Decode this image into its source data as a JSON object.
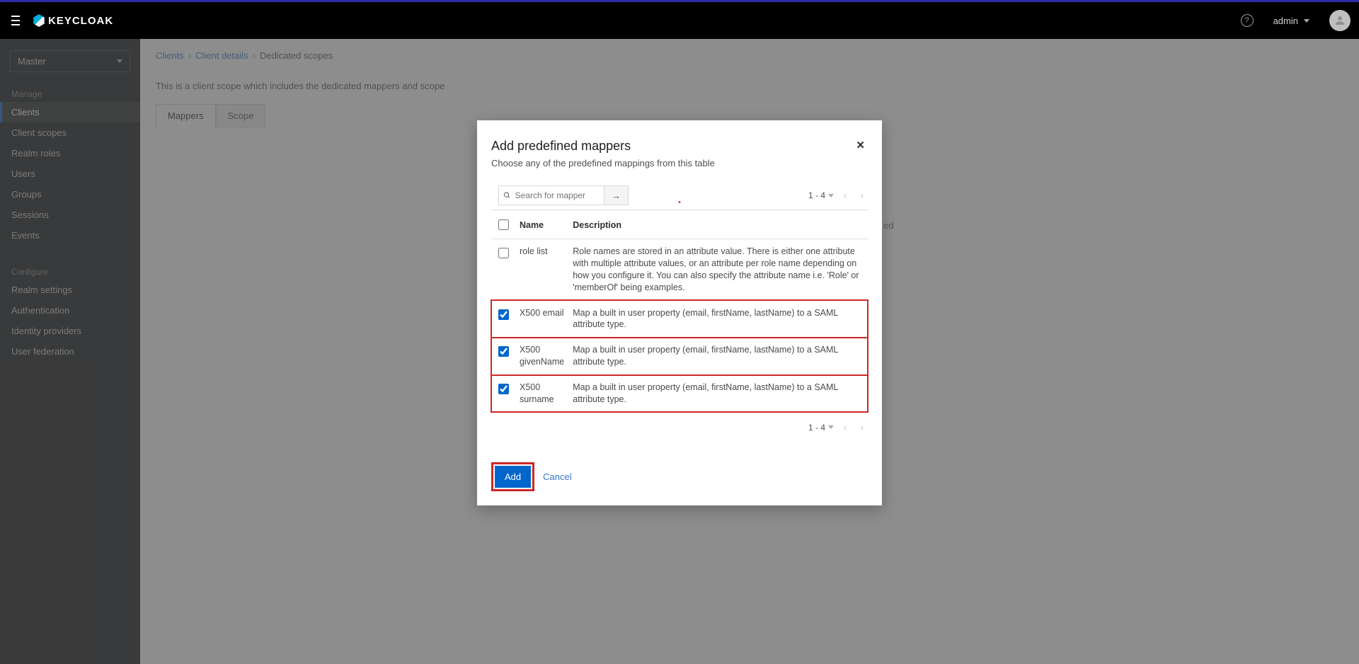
{
  "accentColor": "#2f2aa5",
  "brand": "KEYCLOAK",
  "header": {
    "user": "admin"
  },
  "realmSelector": {
    "selected": "Master"
  },
  "sidebar": {
    "sections": [
      {
        "label": "Manage",
        "items": [
          {
            "label": "Clients",
            "active": true
          },
          {
            "label": "Client scopes"
          },
          {
            "label": "Realm roles"
          },
          {
            "label": "Users"
          },
          {
            "label": "Groups"
          },
          {
            "label": "Sessions"
          },
          {
            "label": "Events"
          }
        ]
      },
      {
        "label": "Configure",
        "items": [
          {
            "label": "Realm settings"
          },
          {
            "label": "Authentication"
          },
          {
            "label": "Identity providers"
          },
          {
            "label": "User federation"
          }
        ]
      }
    ]
  },
  "breadcrumb": {
    "links": [
      "Clients",
      "Client details"
    ],
    "current": "Dedicated scopes"
  },
  "page": {
    "description": "This is a client scope which includes the dedicated mappers and scope",
    "tabs": [
      {
        "label": "Mappers",
        "active": true
      },
      {
        "label": "Scope"
      }
    ],
    "hiddenFragment": "ed"
  },
  "modal": {
    "title": "Add predefined mappers",
    "subtitle": "Choose any of the predefined mappings from this table",
    "searchPlaceholder": "Search for mapper",
    "pager": {
      "range": "1 - 4"
    },
    "columns": {
      "name": "Name",
      "description": "Description"
    },
    "rows": [
      {
        "checked": false,
        "name": "role list",
        "description": "Role names are stored in an attribute value. There is either one attribute with multiple attribute values, or an attribute per role name depending on how you configure it. You can also specify the attribute name i.e. 'Role' or 'memberOf' being examples.",
        "highlight": false
      },
      {
        "checked": true,
        "name": "X500 email",
        "description": "Map a built in user property (email, firstName, lastName) to a SAML attribute type.",
        "highlight": true
      },
      {
        "checked": true,
        "name": "X500 givenName",
        "description": "Map a built in user property (email, firstName, lastName) to a SAML attribute type.",
        "highlight": true
      },
      {
        "checked": true,
        "name": "X500 surname",
        "description": "Map a built in user property (email, firstName, lastName) to a SAML attribute type.",
        "highlight": true
      }
    ],
    "buttons": {
      "add": "Add",
      "cancel": "Cancel"
    }
  }
}
